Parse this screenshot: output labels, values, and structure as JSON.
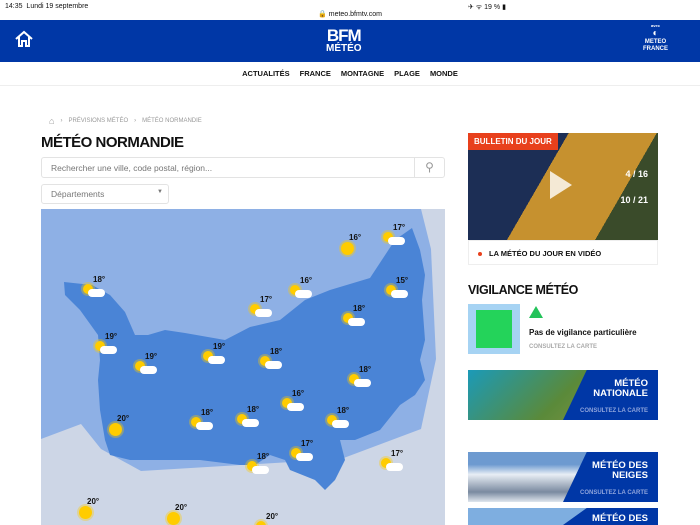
{
  "status": {
    "time": "14:35",
    "date": "Lundi 19 septembre",
    "url": "meteo.bfmtv.com",
    "battery": "19 %"
  },
  "header": {
    "logo_top": "BFM",
    "logo_bottom": "MÉTÉO",
    "partner_avec": "avec",
    "partner_line1": "METEO",
    "partner_line2": "FRANCE"
  },
  "nav": [
    "ACTUALITÉS",
    "FRANCE",
    "MONTAGNE",
    "PLAGE",
    "MONDE"
  ],
  "breadcrumb": [
    "PRÉVISIONS MÉTÉO",
    "MÉTÉO NORMANDIE"
  ],
  "page_title": "MÉTÉO NORMANDIE",
  "search": {
    "placeholder": "Rechercher une ville, code postal, région..."
  },
  "departments": {
    "selected": "Départements"
  },
  "map": {
    "markers": [
      {
        "temp": "16°",
        "icon": "sun"
      },
      {
        "temp": "17°",
        "icon": "partly-cloudy"
      },
      {
        "temp": "18°",
        "icon": "partly-cloudy"
      },
      {
        "temp": "16°",
        "icon": "partly-cloudy"
      },
      {
        "temp": "15°",
        "icon": "partly-cloudy"
      },
      {
        "temp": "17°",
        "icon": "partly-cloudy"
      },
      {
        "temp": "18°",
        "icon": "partly-cloudy"
      },
      {
        "temp": "19°",
        "icon": "partly-cloudy"
      },
      {
        "temp": "19°",
        "icon": "partly-cloudy"
      },
      {
        "temp": "19°",
        "icon": "partly-cloudy"
      },
      {
        "temp": "18°",
        "icon": "partly-cloudy"
      },
      {
        "temp": "18°",
        "icon": "partly-cloudy"
      },
      {
        "temp": "16°",
        "icon": "partly-cloudy"
      },
      {
        "temp": "20°",
        "icon": "sun"
      },
      {
        "temp": "18°",
        "icon": "partly-cloudy"
      },
      {
        "temp": "18°",
        "icon": "partly-cloudy"
      },
      {
        "temp": "18°",
        "icon": "partly-cloudy"
      },
      {
        "temp": "17°",
        "icon": "partly-cloudy"
      },
      {
        "temp": "17°",
        "icon": "partly-cloudy"
      },
      {
        "temp": "18°",
        "icon": "partly-cloudy"
      },
      {
        "temp": "20°",
        "icon": "sun"
      },
      {
        "temp": "20°",
        "icon": "sun"
      },
      {
        "temp": "20°",
        "icon": "partly-cloudy"
      }
    ]
  },
  "bulletin": {
    "tag": "BULLETIN DU JOUR",
    "temp1": "4 / 16",
    "temp2": "10 / 21",
    "caption": "LA MÉTÉO DU JOUR EN VIDÉO"
  },
  "vigilance": {
    "title": "VIGILANCE MÉTÉO",
    "status": "Pas de vigilance particulière",
    "link": "CONSULTEZ LA CARTE"
  },
  "banners": [
    {
      "title1": "MÉTÉO",
      "title2": "NATIONALE",
      "link": "CONSULTEZ LA CARTE"
    },
    {
      "title1": "MÉTÉO DES",
      "title2": "NEIGES",
      "link": "CONSULTEZ LA CARTE"
    },
    {
      "title1": "MÉTÉO DES",
      "title2": "",
      "link": ""
    }
  ]
}
